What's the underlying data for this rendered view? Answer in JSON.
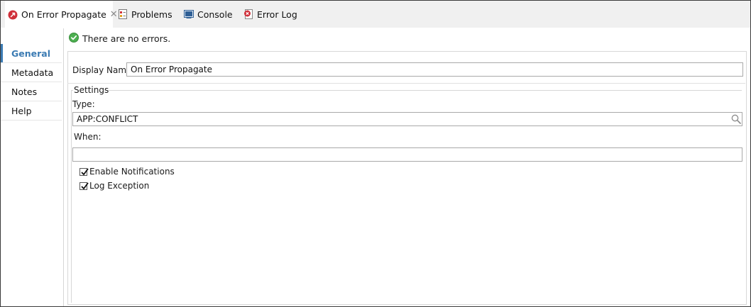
{
  "tabs": [
    {
      "label": "On Error Propagate",
      "icon": "error-propagate-icon",
      "active": true,
      "closable": true
    },
    {
      "label": "Problems",
      "icon": "problems-icon",
      "active": false
    },
    {
      "label": "Console",
      "icon": "console-icon",
      "active": false
    },
    {
      "label": "Error Log",
      "icon": "error-log-icon",
      "active": false
    }
  ],
  "sidebar": {
    "items": [
      {
        "label": "General",
        "active": true
      },
      {
        "label": "Metadata"
      },
      {
        "label": "Notes"
      },
      {
        "label": "Help"
      }
    ]
  },
  "status": {
    "text": "There are no errors.",
    "icon": "check-circle-icon"
  },
  "form": {
    "display_name_label": "Display Name:",
    "display_name_value": "On Error Propagate",
    "settings_title": "Settings",
    "type_label": "Type:",
    "type_value": "APP:CONFLICT",
    "when_label": "When:",
    "when_value": "",
    "enable_notifications_label": "Enable Notifications",
    "enable_notifications_checked": true,
    "log_exception_label": "Log Exception",
    "log_exception_checked": true
  },
  "colors": {
    "accent": "#3b7bb3",
    "success": "#4caf50",
    "error": "#d0303a"
  }
}
